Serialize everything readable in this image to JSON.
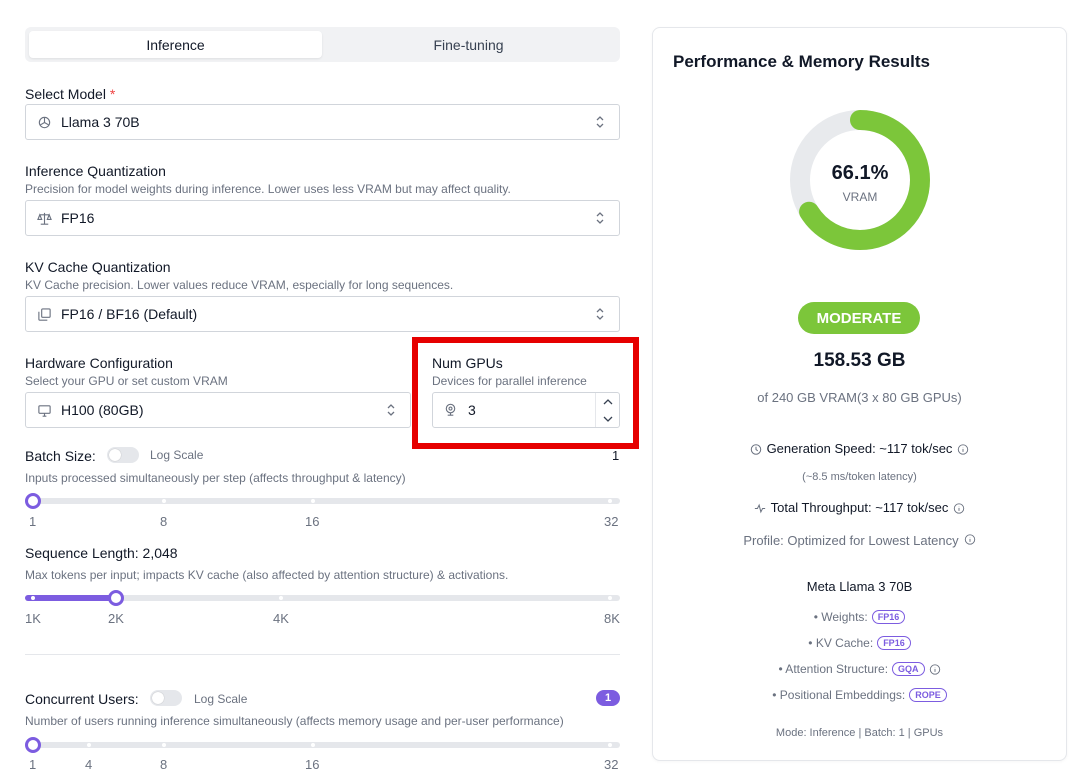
{
  "tabs": {
    "inference": "Inference",
    "finetuning": "Fine-tuning"
  },
  "model": {
    "label": "Select Model",
    "required": "*",
    "value": "Llama 3 70B"
  },
  "inference_quant": {
    "label": "Inference Quantization",
    "help": "Precision for model weights during inference. Lower uses less VRAM but may affect quality.",
    "value": "FP16"
  },
  "kv_quant": {
    "label": "KV Cache Quantization",
    "help": "KV Cache precision. Lower values reduce VRAM, especially for long sequences.",
    "value": "FP16 / BF16 (Default)"
  },
  "hardware": {
    "label": "Hardware Configuration",
    "help": "Select your GPU or set custom VRAM",
    "value": "H100 (80GB)"
  },
  "num_gpus": {
    "label": "Num GPUs",
    "help": "Devices for parallel inference",
    "value": "3"
  },
  "batch": {
    "label": "Batch Size:",
    "log_scale": "Log Scale",
    "value": "1",
    "help": "Inputs processed simultaneously per step (affects throughput & latency)",
    "ticks": [
      "1",
      "8",
      "16",
      "32"
    ]
  },
  "sequence": {
    "label": "Sequence Length: 2,048",
    "help": "Max tokens per input; impacts KV cache (also affected by attention structure) & activations.",
    "ticks": [
      "1K",
      "2K",
      "4K",
      "8K"
    ]
  },
  "users": {
    "label": "Concurrent Users:",
    "log_scale": "Log Scale",
    "value": "1",
    "help": "Number of users running inference simultaneously (affects memory usage and per-user performance)",
    "ticks": [
      "1",
      "4",
      "8",
      "16",
      "32"
    ]
  },
  "results": {
    "title": "Performance & Memory Results",
    "vram_pct": "66.1%",
    "vram_fraction": 0.661,
    "vram_label": "VRAM",
    "status": "MODERATE",
    "used": "158.53 GB",
    "of_total": "of 240 GB VRAM(3 x 80 GB GPUs)",
    "gen_speed": "Generation Speed: ~117 tok/sec",
    "latency": "(~8.5 ms/token latency)",
    "throughput": "Total Throughput: ~117 tok/sec",
    "profile": "Profile: Optimized for Lowest Latency",
    "model_name": "Meta Llama 3 70B",
    "weights_label": "• Weights:",
    "weights_val": "FP16",
    "kv_label": "• KV Cache:",
    "kv_val": "FP16",
    "attn_label": "• Attention Structure:",
    "attn_val": "GQA",
    "pos_label": "• Positional Embeddings:",
    "pos_val": "ROPE",
    "mode": "Mode: Inference | Batch: 1 | GPUs"
  },
  "colors": {
    "accent": "#7c5ce0",
    "good": "#7cc63a",
    "highlight": "#e60000"
  }
}
